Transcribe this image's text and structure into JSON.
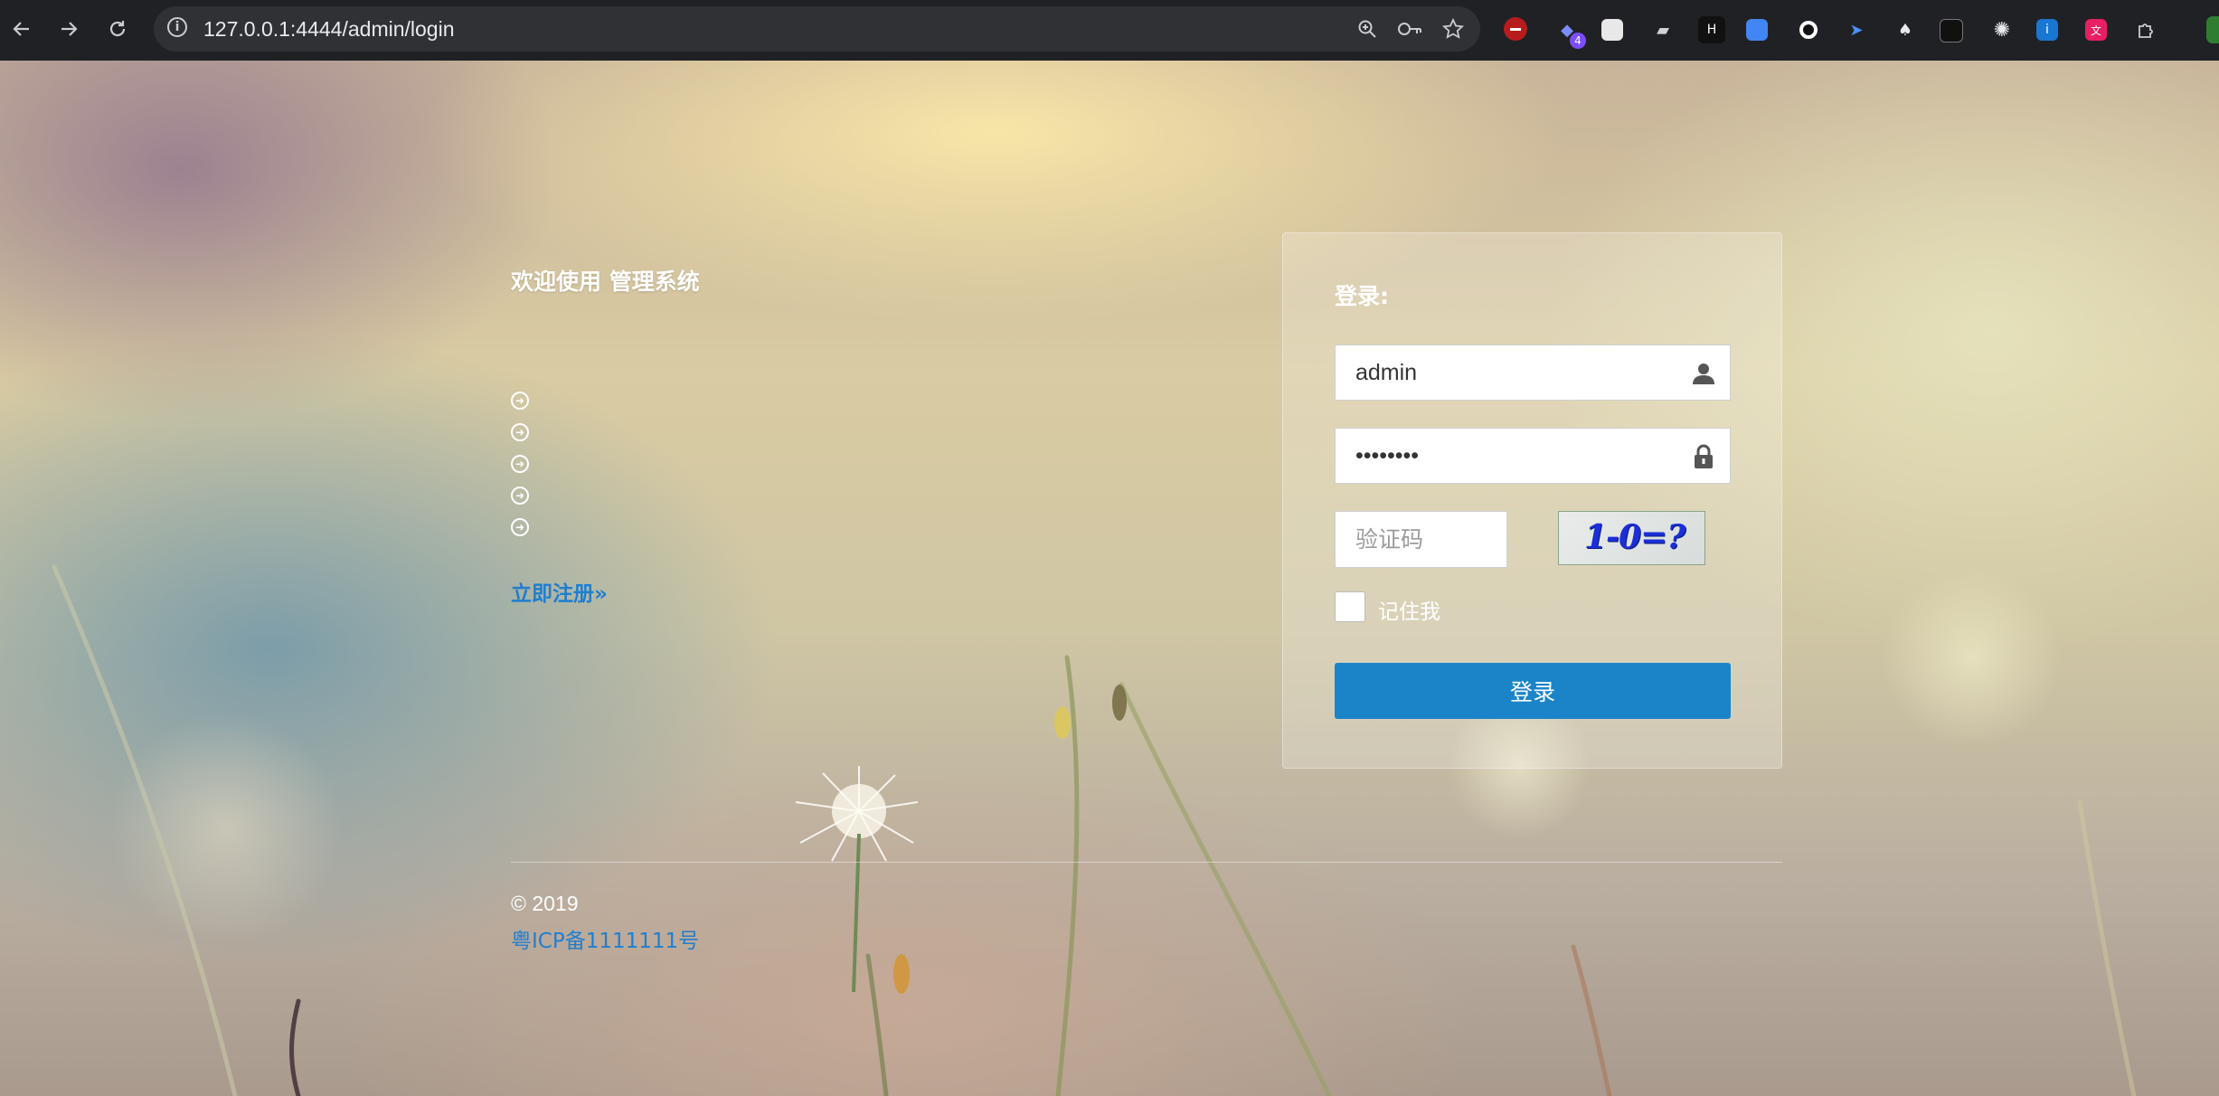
{
  "browser": {
    "url": "127.0.0.1:4444/admin/login",
    "extension_badge": "4"
  },
  "page": {
    "welcome_title": "欢迎使用 管理系统",
    "register_link": "立即注册»",
    "footer": {
      "copyright": "© 2019",
      "icp": "粤ICP备1111111号"
    }
  },
  "login": {
    "title": "登录:",
    "username_value": "admin",
    "password_value": "••••••••",
    "captcha_placeholder": "验证码",
    "captcha_text": "1-0=?",
    "remember_label": "记住我",
    "remember_checked": false,
    "submit_label": "登录"
  },
  "colors": {
    "primary_button": "#1b84c9",
    "link": "#1f7fd0",
    "chrome_bg": "#202124"
  }
}
